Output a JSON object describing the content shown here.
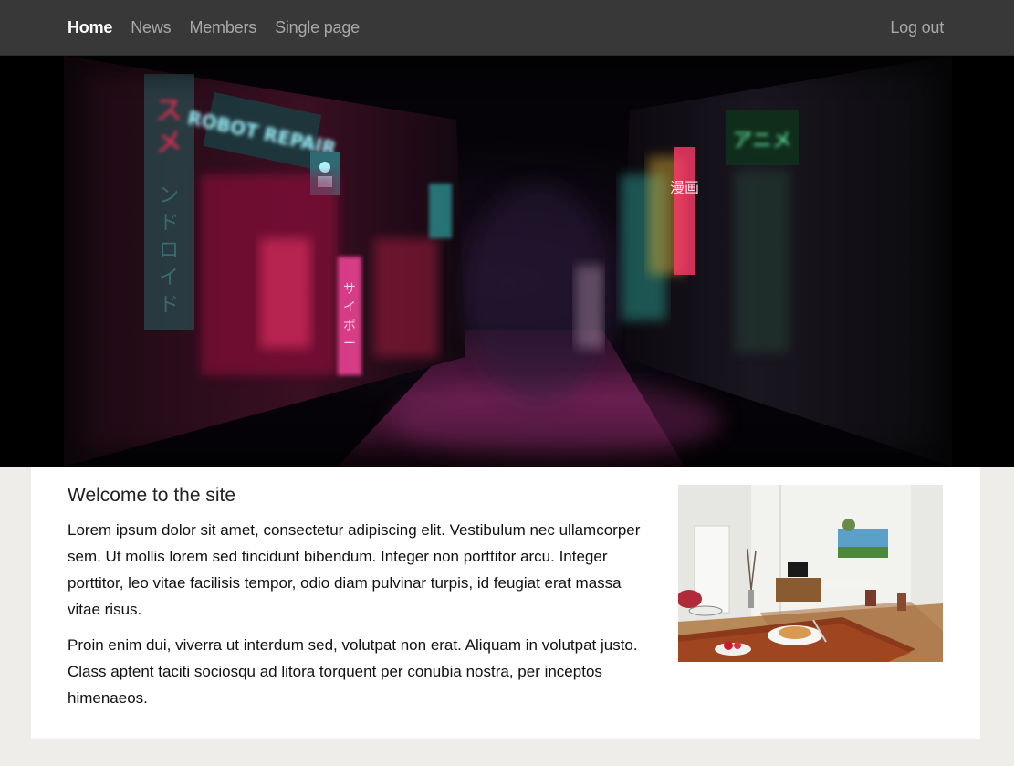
{
  "nav": {
    "items": [
      {
        "label": "Home",
        "active": true
      },
      {
        "label": "News",
        "active": false
      },
      {
        "label": "Members",
        "active": false
      },
      {
        "label": "Single page",
        "active": false
      }
    ],
    "logout_label": "Log out"
  },
  "hero": {
    "image": "neon-alley-banner",
    "sign_robot_repair": "ROBOT REPAIR",
    "sign_anime": "アニメ",
    "sign_manga": "漫画"
  },
  "main": {
    "title": "Welcome to the site",
    "paragraphs": [
      "Lorem ipsum dolor sit amet, consectetur adipiscing elit. Vestibulum nec ullamcorper sem. Ut mollis lorem sed tincidunt bibendum. Integer non porttitor arcu. Integer porttitor, leo vitae facilisis tempor, odio diam pulvinar turpis, id feugiat erat massa vitae risus.",
      "Proin enim dui, viverra ut interdum sed, volutpat non erat. Aliquam in volutpat justo. Class aptent taciti sociosqu ad litora torquent per conubia nostra, per inceptos himenaeos."
    ],
    "photo": "apartment-interior-photo"
  },
  "colors": {
    "navbar": "#383838",
    "page_background": "#eeede9",
    "card_background": "#ffffff",
    "nav_active": "#ffffff",
    "nav_inactive": "#a8a8a8"
  }
}
